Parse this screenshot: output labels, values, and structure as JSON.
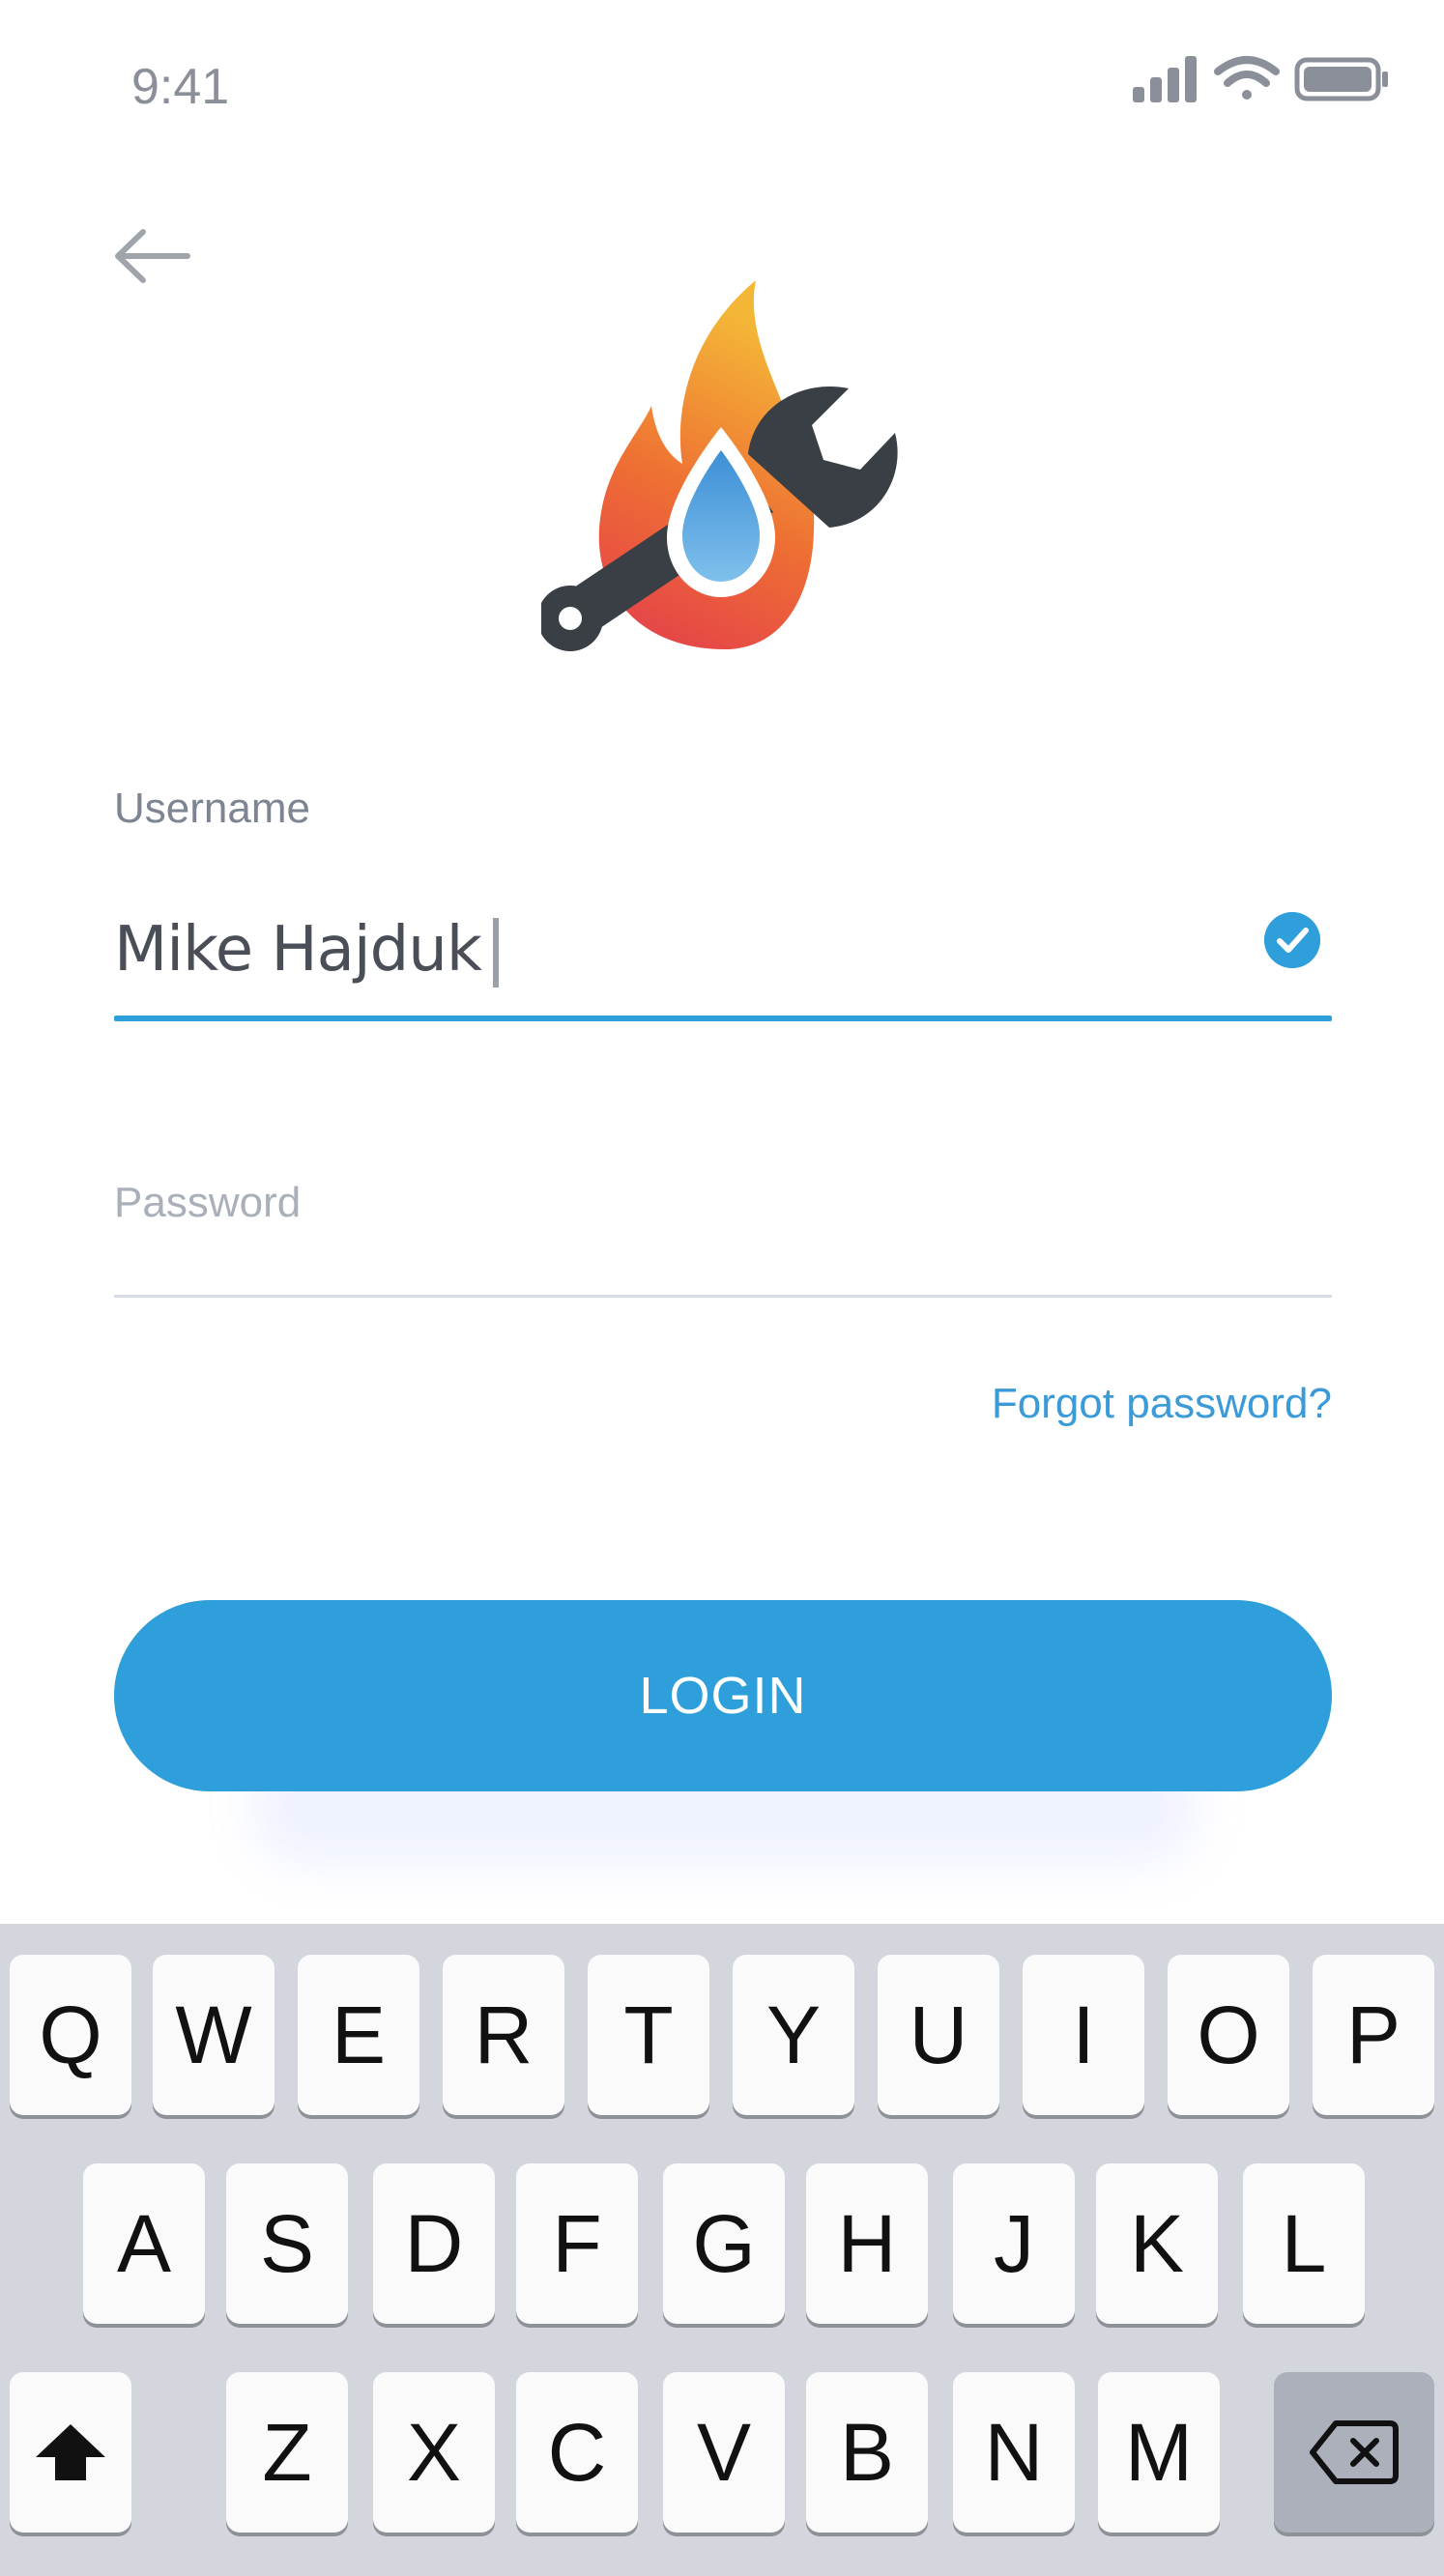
{
  "status_bar": {
    "time": "9:41"
  },
  "icons": {
    "back": "arrow-left-icon",
    "logo": "fire-water-wrench-logo",
    "check": "check-circle-icon",
    "shift": "shift-icon",
    "backspace": "backspace-icon"
  },
  "form": {
    "username_label": "Username",
    "username_value": "Mike Hajduk",
    "password_placeholder": "Password",
    "forgot_password": "Forgot password?",
    "login_button": "LOGIN"
  },
  "keyboard": {
    "row1": [
      "Q",
      "W",
      "E",
      "R",
      "T",
      "Y",
      "U",
      "I",
      "O",
      "P"
    ],
    "row2": [
      "A",
      "S",
      "D",
      "F",
      "G",
      "H",
      "J",
      "K",
      "L"
    ],
    "row3": [
      "Z",
      "X",
      "C",
      "V",
      "B",
      "N",
      "M"
    ]
  },
  "colors": {
    "accent": "#2e9fda",
    "keyboard_bg": "#d3d6dc",
    "key_bg": "#fafafa"
  }
}
